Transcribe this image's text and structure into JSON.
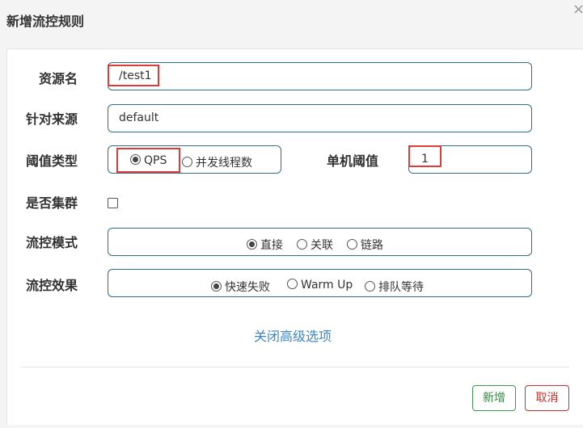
{
  "dialog": {
    "title": "新增流控规则",
    "close_glyph": "×"
  },
  "form": {
    "resource_name": {
      "label": "资源名",
      "value": "/test1"
    },
    "limit_app": {
      "label": "针对来源",
      "value": "default"
    },
    "threshold_type": {
      "label": "阈值类型",
      "options": [
        {
          "label": "QPS",
          "selected": true
        },
        {
          "label": "并发线程数",
          "selected": false
        }
      ]
    },
    "single_threshold": {
      "label": "单机阈值",
      "value": "1"
    },
    "cluster_mode": {
      "label": "是否集群",
      "checked": false
    },
    "flow_mode": {
      "label": "流控模式",
      "options": [
        {
          "label": "直接",
          "selected": true
        },
        {
          "label": "关联",
          "selected": false
        },
        {
          "label": "链路",
          "selected": false
        }
      ]
    },
    "control_behavior": {
      "label": "流控效果",
      "options": [
        {
          "label": "快速失败",
          "selected": true
        },
        {
          "label": "Warm Up",
          "selected": false
        },
        {
          "label": "排队等待",
          "selected": false
        }
      ]
    },
    "advanced_link": "关闭高级选项"
  },
  "footer": {
    "add_label": "新增",
    "cancel_label": "取消"
  },
  "colors": {
    "input_border": "#2f6e8f",
    "highlight_red": "#e03a3a",
    "link_blue": "#3b87c8",
    "add_green": "#2f8a3c",
    "cancel_red": "#c9302c"
  }
}
